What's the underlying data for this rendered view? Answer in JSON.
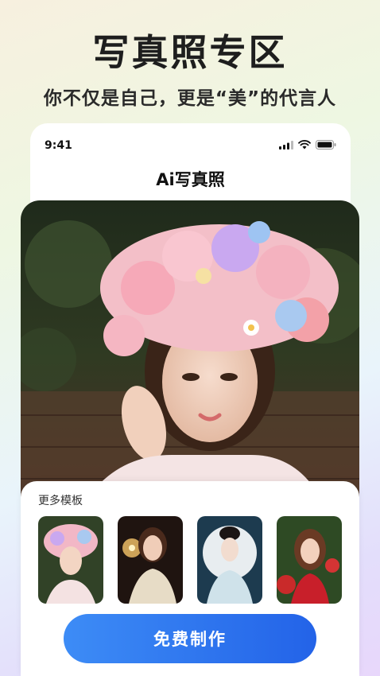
{
  "promo": {
    "headline": "写真照专区",
    "subline": "你不仅是自己，更是“美”的代言人"
  },
  "status_bar": {
    "time": "9:41",
    "icons": [
      "signal-icon",
      "wifi-icon",
      "battery-icon"
    ]
  },
  "app": {
    "title": "Ai写真照"
  },
  "hero": {
    "description_icon": "portrait-photo"
  },
  "templates": {
    "title": "更多模板",
    "items": [
      {
        "name": "flower-crown-portrait"
      },
      {
        "name": "sparkler-portrait"
      },
      {
        "name": "moon-hanfu-portrait"
      },
      {
        "name": "red-roses-portrait"
      }
    ]
  },
  "cta": {
    "label": "免费制作"
  },
  "colors": {
    "accent": "#2f74f0",
    "accent_light": "#3d8cf6"
  }
}
